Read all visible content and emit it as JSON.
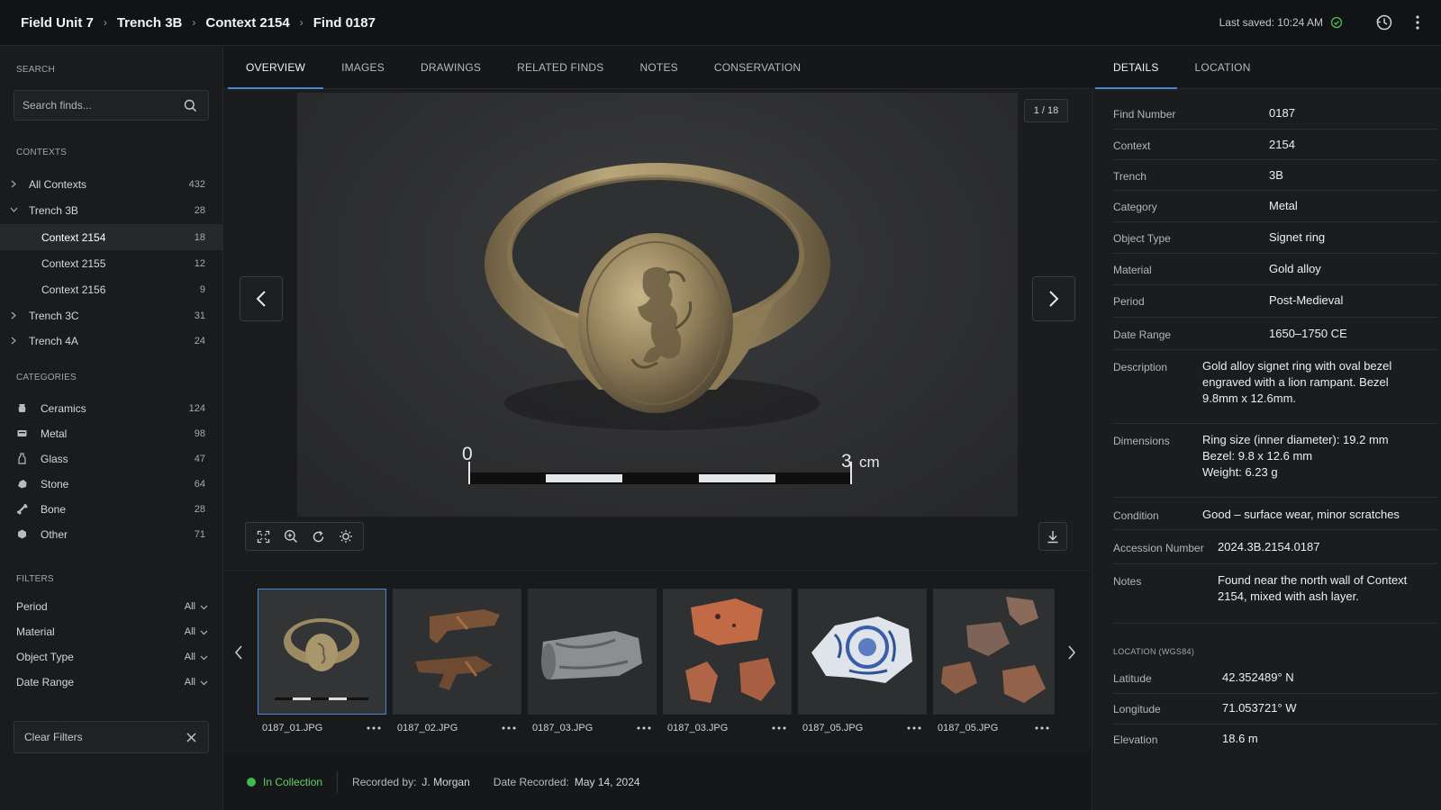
{
  "breadcrumb": [
    "Field Unit 7",
    "Trench 3B",
    "Context 2154",
    "Find 0187"
  ],
  "last_saved": "Last saved: 10:24 AM",
  "sidebar": {
    "search_label": "SEARCH",
    "search_placeholder": "Search finds...",
    "contexts_label": "CONTEXTS",
    "contexts": [
      {
        "label": "All Contexts",
        "count": "432",
        "level": 0,
        "expanded": false
      },
      {
        "label": "Trench 3B",
        "count": "28",
        "level": 0,
        "expanded": true
      },
      {
        "label": "Context 2154",
        "count": "18",
        "level": 1,
        "selected": true
      },
      {
        "label": "Context 2155",
        "count": "12",
        "level": 1
      },
      {
        "label": "Context 2156",
        "count": "9",
        "level": 1
      },
      {
        "label": "Trench 3C",
        "count": "31",
        "level": 0,
        "expanded": false
      },
      {
        "label": "Trench 4A",
        "count": "24",
        "level": 0,
        "expanded": false
      }
    ],
    "categories_label": "CATEGORIES",
    "categories": [
      {
        "label": "Ceramics",
        "count": "124",
        "icon": "ceramics-icon"
      },
      {
        "label": "Metal",
        "count": "98",
        "icon": "metal-icon"
      },
      {
        "label": "Glass",
        "count": "47",
        "icon": "glass-icon"
      },
      {
        "label": "Stone",
        "count": "64",
        "icon": "stone-icon"
      },
      {
        "label": "Bone",
        "count": "28",
        "icon": "bone-icon"
      },
      {
        "label": "Other",
        "count": "71",
        "icon": "other-icon"
      }
    ],
    "filters_label": "FILTERS",
    "filters": [
      {
        "label": "Period",
        "value": "All"
      },
      {
        "label": "Material",
        "value": "All"
      },
      {
        "label": "Object Type",
        "value": "All"
      },
      {
        "label": "Date Range",
        "value": "All"
      }
    ],
    "clear_filters": "Clear Filters"
  },
  "main_tabs": [
    "OVERVIEW",
    "IMAGES",
    "DRAWINGS",
    "RELATED FINDS",
    "NOTES",
    "CONSERVATION"
  ],
  "active_main_tab": 0,
  "viewer": {
    "counter": "1 / 18",
    "scale_start": "0",
    "scale_end": "3",
    "scale_unit": "cm"
  },
  "thumbnails": [
    {
      "name": "0187_01.JPG",
      "kind": "ring",
      "selected": true
    },
    {
      "name": "0187_02.JPG",
      "kind": "iron"
    },
    {
      "name": "0187_03.JPG",
      "kind": "lead"
    },
    {
      "name": "0187_03.JPG",
      "kind": "sherds"
    },
    {
      "name": "0187_05.JPG",
      "kind": "porcelain"
    },
    {
      "name": "0187_05.JPG",
      "kind": "fragments"
    }
  ],
  "status": {
    "state": "In Collection",
    "recorded_by_label": "Recorded by:",
    "recorded_by": "J. Morgan",
    "date_label": "Date Recorded:",
    "date": "May 14, 2024"
  },
  "right_tabs": [
    "DETAILS",
    "LOCATION"
  ],
  "active_right_tab": 0,
  "details": [
    {
      "key": "Find Number",
      "value": "0187"
    },
    {
      "key": "Context",
      "value": "2154"
    },
    {
      "key": "Trench",
      "value": "3B"
    },
    {
      "key": "Category",
      "value": "Metal"
    },
    {
      "key": "Object Type",
      "value": "Signet ring"
    },
    {
      "key": "Material",
      "value": "Gold alloy"
    },
    {
      "key": "Period",
      "value": "Post-Medieval"
    },
    {
      "key": "Date Range",
      "value": "1650–1750 CE"
    },
    {
      "key": "Description",
      "value": "Gold alloy signet ring with oval bezel engraved with a lion rampant. Bezel 9.8mm x 12.6mm."
    },
    {
      "key": "Dimensions",
      "value": "Ring size (inner diameter): 19.2 mm\nBezel: 9.8 x 12.6 mm\nWeight: 6.23 g"
    },
    {
      "key": "Condition",
      "value": "Good – surface wear, minor scratches"
    },
    {
      "key": "Accession Number",
      "value": "2024.3B.2154.0187"
    },
    {
      "key": "Notes",
      "value": "Found near the north wall of Context 2154, mixed with ash layer."
    }
  ],
  "location_label": "LOCATION (WGS84)",
  "location": [
    {
      "key": "Latitude",
      "value": "42.352489° N"
    },
    {
      "key": "Longitude",
      "value": "71.053721° W"
    },
    {
      "key": "Elevation",
      "value": "18.6 m"
    }
  ],
  "colors": {
    "accent": "#4a86d8",
    "status_ok": "#3fba4f",
    "background": "#161718"
  }
}
